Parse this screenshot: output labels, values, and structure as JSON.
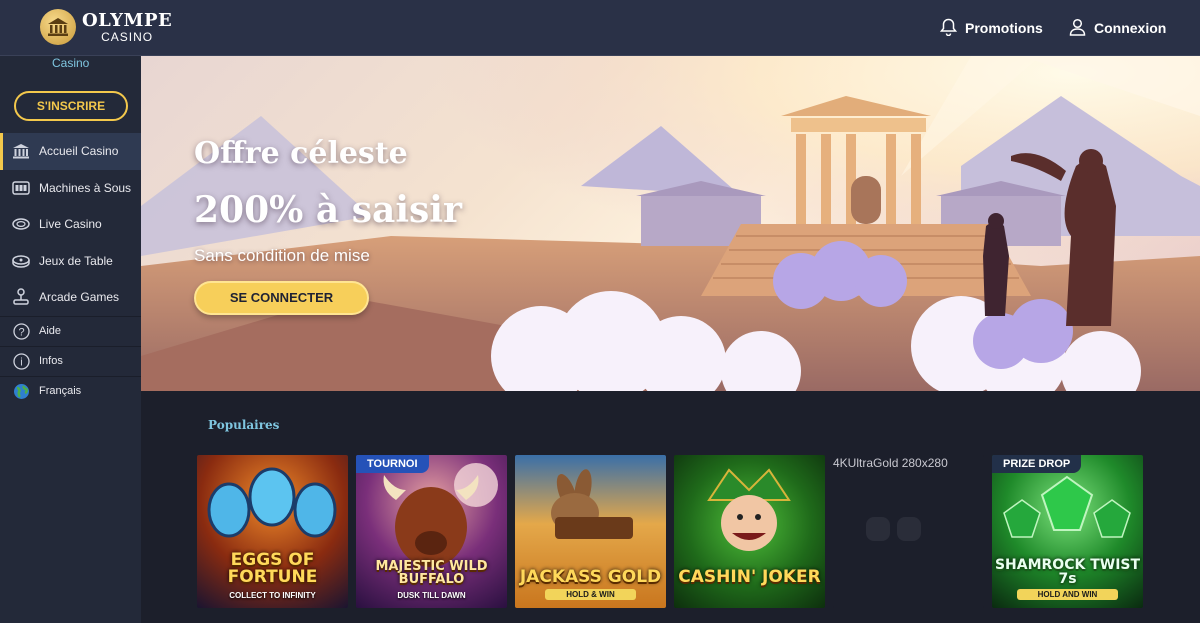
{
  "header": {
    "logo_title": "OLYMPE",
    "logo_sub": "CASINO",
    "promotions_label": "Promotions",
    "login_label": "Connexion"
  },
  "sidebar": {
    "caption": "Casino",
    "signup_label": "S'INSCRIRE",
    "items": [
      {
        "label": "Accueil Casino",
        "icon": "temple-icon",
        "active": true
      },
      {
        "label": "Machines à Sous",
        "icon": "slot-machine-icon"
      },
      {
        "label": "Live Casino",
        "icon": "live-casino-icon"
      },
      {
        "label": "Jeux de Table",
        "icon": "table-games-icon"
      },
      {
        "label": "Arcade Games",
        "icon": "joystick-icon"
      },
      {
        "label": "Aide",
        "icon": "help-icon"
      },
      {
        "label": "Infos",
        "icon": "info-icon"
      },
      {
        "label": "Français",
        "icon": "globe-icon"
      }
    ]
  },
  "hero": {
    "title_line1": "Offre céleste",
    "title_line2": "200% à saisir",
    "subtitle": "Sans condition de mise",
    "cta_label": "SE CONNECTER"
  },
  "popular": {
    "title": "Populaires",
    "games": [
      {
        "name": "EGGS OF FORTUNE",
        "subtitle": "COLLECT TO INFINITY",
        "tag": ""
      },
      {
        "name": "MAJESTIC WILD BUFFALO",
        "subtitle": "DUSK TILL DAWN",
        "tag": "TOURNOI"
      },
      {
        "name": "JACKASS GOLD",
        "subtitle": "HOLD & WIN",
        "tag": ""
      },
      {
        "name": "CASHIN' JOKER",
        "subtitle": "",
        "tag": ""
      },
      {
        "name": "4KUltraGold 280x280",
        "subtitle": "",
        "tag": ""
      },
      {
        "name": "SHAMROCK TWIST 7s",
        "subtitle": "HOLD AND WIN",
        "tag": "PRIZE DROP"
      }
    ]
  },
  "colors": {
    "accent": "#f3c84c",
    "header_bg": "#2a3147",
    "sidebar_bg": "#232939",
    "page_bg": "#1c1f2b",
    "caption": "#7fc6e0",
    "tag_blue": "#2552b8"
  }
}
